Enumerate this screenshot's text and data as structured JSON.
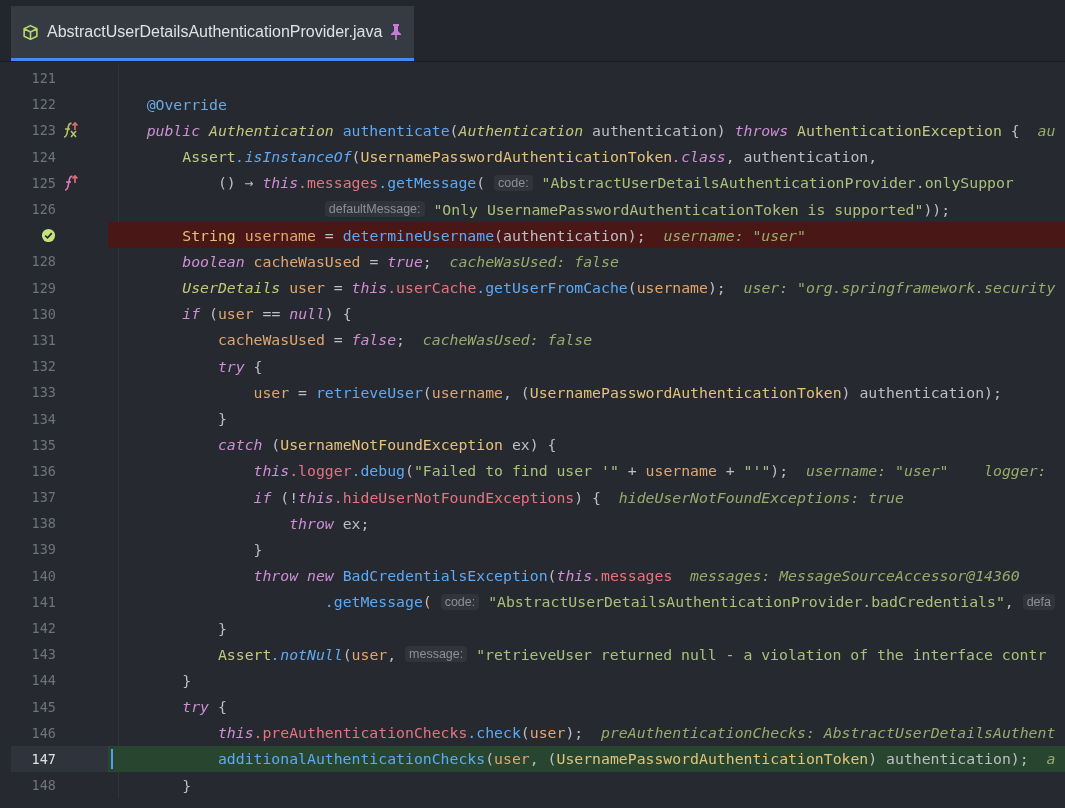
{
  "tab": {
    "title": "AbstractUserDetailsAuthenticationProvider.java",
    "selected": true,
    "pinned": true
  },
  "lines": [
    {
      "number": "121"
    },
    {
      "number": "122",
      "tokens": [
        {
          "kind": "annot",
          "text": "    @Override"
        }
      ]
    },
    {
      "number": "123",
      "gutter_icon": {
        "kind": "fx"
      },
      "tokens": [
        {
          "kind": "kw",
          "text": "    public "
        },
        {
          "kind": "type",
          "text": "Authentication "
        },
        {
          "kind": "method",
          "text": "authenticate"
        },
        {
          "kind": "plain",
          "text": "("
        },
        {
          "kind": "type",
          "text": "Authentication"
        },
        {
          "kind": "plain",
          "text": " authentication) "
        },
        {
          "kind": "kw",
          "text": "throws "
        },
        {
          "kind": "cls",
          "text": "AuthenticationException"
        },
        {
          "kind": "plain",
          "text": " {  "
        },
        {
          "kind": "hint",
          "text": "au"
        }
      ]
    },
    {
      "number": "124",
      "tokens": [
        {
          "kind": "cls",
          "text": "        Assert"
        },
        {
          "kind": "smethod",
          "text": ".isInstanceOf"
        },
        {
          "kind": "plain",
          "text": "("
        },
        {
          "kind": "yel",
          "text": "UsernamePasswordAuthenticationToken"
        },
        {
          "kind": "kw",
          "text": ".class"
        },
        {
          "kind": "plain",
          "text": ", authentication,"
        }
      ]
    },
    {
      "number": "125",
      "gutter_icon": {
        "kind": "f"
      },
      "tokens": [
        {
          "kind": "plain",
          "text": "            () → "
        },
        {
          "kind": "kw",
          "text": "this"
        },
        {
          "kind": "field",
          "text": ".messages"
        },
        {
          "kind": "method",
          "text": ".getMessage"
        },
        {
          "kind": "plain",
          "text": "( "
        },
        {
          "kind": "inlay",
          "text": "code:"
        },
        {
          "kind": "str",
          "text": " \"AbstractUserDetailsAuthenticationProvider.onlySuppor"
        }
      ]
    },
    {
      "number": "126",
      "tokens": [
        {
          "kind": "inlay",
          "text": "                        defaultMessage:"
        },
        {
          "kind": "str",
          "text": " \"Only UsernamePasswordAuthenticationToken is supported\""
        },
        {
          "kind": "plain",
          "text": "));"
        }
      ]
    },
    {
      "breakpoint": true,
      "tokens": [
        {
          "kind": "yel",
          "text": "        String "
        },
        {
          "kind": "local",
          "text": "username"
        },
        {
          "kind": "plain",
          "text": " = "
        },
        {
          "kind": "method",
          "text": "determineUsername"
        },
        {
          "kind": "plain",
          "text": "(authentication);  "
        },
        {
          "kind": "hint",
          "text": "username: \"user\""
        }
      ]
    },
    {
      "number": "128",
      "tokens": [
        {
          "kind": "kw",
          "text": "        boolean "
        },
        {
          "kind": "local",
          "text": "cacheWasUsed"
        },
        {
          "kind": "plain",
          "text": " = "
        },
        {
          "kind": "kw",
          "text": "true"
        },
        {
          "kind": "plain",
          "text": ";  "
        },
        {
          "kind": "hint",
          "text": "cacheWasUsed: false"
        }
      ]
    },
    {
      "number": "129",
      "tokens": [
        {
          "kind": "type",
          "text": "        UserDetails "
        },
        {
          "kind": "local",
          "text": "user"
        },
        {
          "kind": "plain",
          "text": " = "
        },
        {
          "kind": "kw",
          "text": "this"
        },
        {
          "kind": "field",
          "text": ".userCache"
        },
        {
          "kind": "method",
          "text": ".getUserFromCache"
        },
        {
          "kind": "plain",
          "text": "("
        },
        {
          "kind": "local",
          "text": "username"
        },
        {
          "kind": "plain",
          "text": ");  "
        },
        {
          "kind": "hint",
          "text": "user: \"org.springframework.security"
        }
      ]
    },
    {
      "number": "130",
      "tokens": [
        {
          "kind": "kw",
          "text": "        if"
        },
        {
          "kind": "plain",
          "text": " ("
        },
        {
          "kind": "local",
          "text": "user"
        },
        {
          "kind": "plain",
          "text": " == "
        },
        {
          "kind": "kw",
          "text": "null"
        },
        {
          "kind": "plain",
          "text": ") {"
        }
      ]
    },
    {
      "number": "131",
      "tokens": [
        {
          "kind": "local",
          "text": "            cacheWasUsed"
        },
        {
          "kind": "plain",
          "text": " = "
        },
        {
          "kind": "kw",
          "text": "false"
        },
        {
          "kind": "plain",
          "text": ";  "
        },
        {
          "kind": "hint",
          "text": "cacheWasUsed: false"
        }
      ]
    },
    {
      "number": "132",
      "tokens": [
        {
          "kind": "kw",
          "text": "            try"
        },
        {
          "kind": "plain",
          "text": " {"
        }
      ]
    },
    {
      "number": "133",
      "tokens": [
        {
          "kind": "local",
          "text": "                user"
        },
        {
          "kind": "plain",
          "text": " = "
        },
        {
          "kind": "method",
          "text": "retrieveUser"
        },
        {
          "kind": "plain",
          "text": "("
        },
        {
          "kind": "local",
          "text": "username"
        },
        {
          "kind": "plain",
          "text": ", ("
        },
        {
          "kind": "yel",
          "text": "UsernamePasswordAuthenticationToken"
        },
        {
          "kind": "plain",
          "text": ") authentication);"
        }
      ]
    },
    {
      "number": "134",
      "tokens": [
        {
          "kind": "plain",
          "text": "            }"
        }
      ]
    },
    {
      "number": "135",
      "tokens": [
        {
          "kind": "kw",
          "text": "            catch"
        },
        {
          "kind": "plain",
          "text": " ("
        },
        {
          "kind": "yel",
          "text": "UsernameNotFoundException"
        },
        {
          "kind": "plain",
          "text": " ex) {"
        }
      ]
    },
    {
      "number": "136",
      "tokens": [
        {
          "kind": "kw",
          "text": "                this"
        },
        {
          "kind": "field",
          "text": ".logger"
        },
        {
          "kind": "method",
          "text": ".debug"
        },
        {
          "kind": "plain",
          "text": "("
        },
        {
          "kind": "str",
          "text": "\"Failed to find user '\""
        },
        {
          "kind": "plain",
          "text": " + "
        },
        {
          "kind": "local",
          "text": "username"
        },
        {
          "kind": "plain",
          "text": " + "
        },
        {
          "kind": "str",
          "text": "\"'\""
        },
        {
          "kind": "plain",
          "text": ");  "
        },
        {
          "kind": "hint",
          "text": "username: \"user\"    logger:"
        }
      ]
    },
    {
      "number": "137",
      "tokens": [
        {
          "kind": "kw",
          "text": "                if"
        },
        {
          "kind": "plain",
          "text": " (!"
        },
        {
          "kind": "kw",
          "text": "this"
        },
        {
          "kind": "field",
          "text": ".hideUserNotFoundExceptions"
        },
        {
          "kind": "plain",
          "text": ") {  "
        },
        {
          "kind": "hint",
          "text": "hideUserNotFoundExceptions: true"
        }
      ]
    },
    {
      "number": "138",
      "tokens": [
        {
          "kind": "kw",
          "text": "                    throw"
        },
        {
          "kind": "plain",
          "text": " ex;"
        }
      ]
    },
    {
      "number": "139",
      "tokens": [
        {
          "kind": "plain",
          "text": "                }"
        }
      ]
    },
    {
      "number": "140",
      "tokens": [
        {
          "kind": "kw",
          "text": "                throw new "
        },
        {
          "kind": "method",
          "text": "BadCredentialsException"
        },
        {
          "kind": "plain",
          "text": "("
        },
        {
          "kind": "kw",
          "text": "this"
        },
        {
          "kind": "field",
          "text": ".messages  "
        },
        {
          "kind": "hint",
          "text": "messages: MessageSourceAccessor@14360"
        }
      ]
    },
    {
      "number": "141",
      "tokens": [
        {
          "kind": "method",
          "text": "                        .getMessage"
        },
        {
          "kind": "plain",
          "text": "( "
        },
        {
          "kind": "inlay",
          "text": "code:"
        },
        {
          "kind": "str",
          "text": " \"AbstractUserDetailsAuthenticationProvider.badCredentials\""
        },
        {
          "kind": "plain",
          "text": ", "
        },
        {
          "kind": "inlay",
          "text": "defa"
        }
      ]
    },
    {
      "number": "142",
      "tokens": [
        {
          "kind": "plain",
          "text": "            }"
        }
      ]
    },
    {
      "number": "143",
      "tokens": [
        {
          "kind": "cls",
          "text": "            Assert"
        },
        {
          "kind": "smethod",
          "text": ".notNull"
        },
        {
          "kind": "plain",
          "text": "("
        },
        {
          "kind": "local",
          "text": "user"
        },
        {
          "kind": "plain",
          "text": ", "
        },
        {
          "kind": "inlay",
          "text": "message:"
        },
        {
          "kind": "str",
          "text": " \"retrieveUser returned null - a violation of the interface contr"
        }
      ]
    },
    {
      "number": "144",
      "tokens": [
        {
          "kind": "plain",
          "text": "        }"
        }
      ]
    },
    {
      "number": "145",
      "tokens": [
        {
          "kind": "kw",
          "text": "        try"
        },
        {
          "kind": "plain",
          "text": " {"
        }
      ]
    },
    {
      "number": "146",
      "tokens": [
        {
          "kind": "kw",
          "text": "            this"
        },
        {
          "kind": "field",
          "text": ".preAuthenticationChecks"
        },
        {
          "kind": "method",
          "text": ".check"
        },
        {
          "kind": "plain",
          "text": "("
        },
        {
          "kind": "local",
          "text": "user"
        },
        {
          "kind": "plain",
          "text": ");  "
        },
        {
          "kind": "hint",
          "text": "preAuthenticationChecks: AbstractUserDetailsAuthent"
        }
      ]
    },
    {
      "number": "147",
      "current": true,
      "tokens": [
        {
          "kind": "method",
          "text": "            additionalAuthenticationChecks"
        },
        {
          "kind": "plain",
          "text": "("
        },
        {
          "kind": "local",
          "text": "user"
        },
        {
          "kind": "plain",
          "text": ", ("
        },
        {
          "kind": "yel",
          "text": "UsernamePasswordAuthenticationToken"
        },
        {
          "kind": "plain",
          "text": ") authentication);  "
        },
        {
          "kind": "hint",
          "text": "a"
        }
      ]
    },
    {
      "number": "148",
      "tokens": [
        {
          "kind": "plain",
          "text": "        }"
        }
      ]
    }
  ]
}
